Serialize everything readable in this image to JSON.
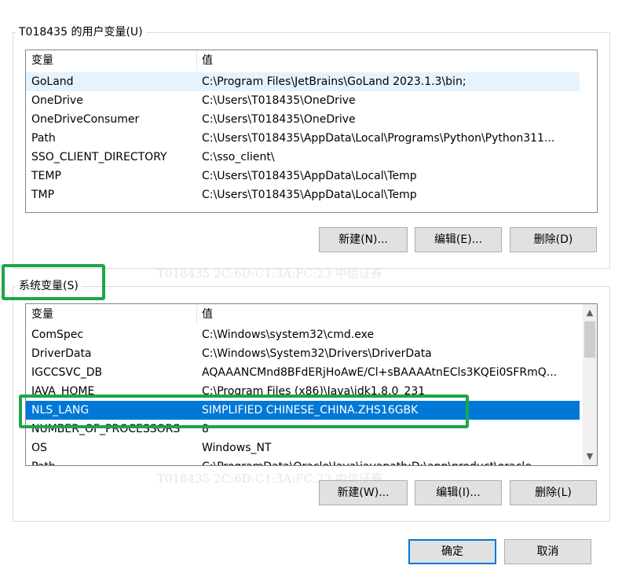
{
  "user_vars": {
    "title": "T018435 的用户变量(U)",
    "col_name": "变量",
    "col_value": "值",
    "rows": [
      {
        "name": "GoLand",
        "value": "C:\\Program Files\\JetBrains\\GoLand 2023.1.3\\bin;"
      },
      {
        "name": "OneDrive",
        "value": "C:\\Users\\T018435\\OneDrive"
      },
      {
        "name": "OneDriveConsumer",
        "value": "C:\\Users\\T018435\\OneDrive"
      },
      {
        "name": "Path",
        "value": "C:\\Users\\T018435\\AppData\\Local\\Programs\\Python\\Python311..."
      },
      {
        "name": "SSO_CLIENT_DIRECTORY",
        "value": "C:\\sso_client\\"
      },
      {
        "name": "TEMP",
        "value": "C:\\Users\\T018435\\AppData\\Local\\Temp"
      },
      {
        "name": "TMP",
        "value": "C:\\Users\\T018435\\AppData\\Local\\Temp"
      }
    ],
    "new_label": "新建(N)...",
    "edit_label": "编辑(E)...",
    "delete_label": "删除(D)"
  },
  "system_vars": {
    "title": "系统变量(S)",
    "col_name": "变量",
    "col_value": "值",
    "rows": [
      {
        "name": "ComSpec",
        "value": "C:\\Windows\\system32\\cmd.exe"
      },
      {
        "name": "DriverData",
        "value": "C:\\Windows\\System32\\Drivers\\DriverData"
      },
      {
        "name": "IGCCSVC_DB",
        "value": "AQAAANCMnd8BFdERjHoAwE/Cl+sBAAAAtnECls3KQEi0SFRmQ..."
      },
      {
        "name": "JAVA_HOME",
        "value": "C:\\Program Files (x86)\\Java\\jdk1.8.0_231"
      },
      {
        "name": "NLS_LANG",
        "value": "SIMPLIFIED CHINESE_CHINA.ZHS16GBK"
      },
      {
        "name": "NUMBER_OF_PROCESSORS",
        "value": "8"
      },
      {
        "name": "OS",
        "value": "Windows_NT"
      },
      {
        "name": "Path",
        "value": "C:\\ProgramData\\Oracle\\Java\\javapath;D:\\app\\product\\oracle"
      }
    ],
    "new_label": "新建(W)...",
    "edit_label": "编辑(I)...",
    "delete_label": "删除(L)"
  },
  "footer": {
    "ok_label": "确定",
    "cancel_label": "取消"
  },
  "watermark": {
    "text": "T018435   2C:6D:C1:3A:FC:23   中信证券"
  },
  "colors": {
    "selection": "#0078d7",
    "highlight_box": "#1ea54a"
  }
}
